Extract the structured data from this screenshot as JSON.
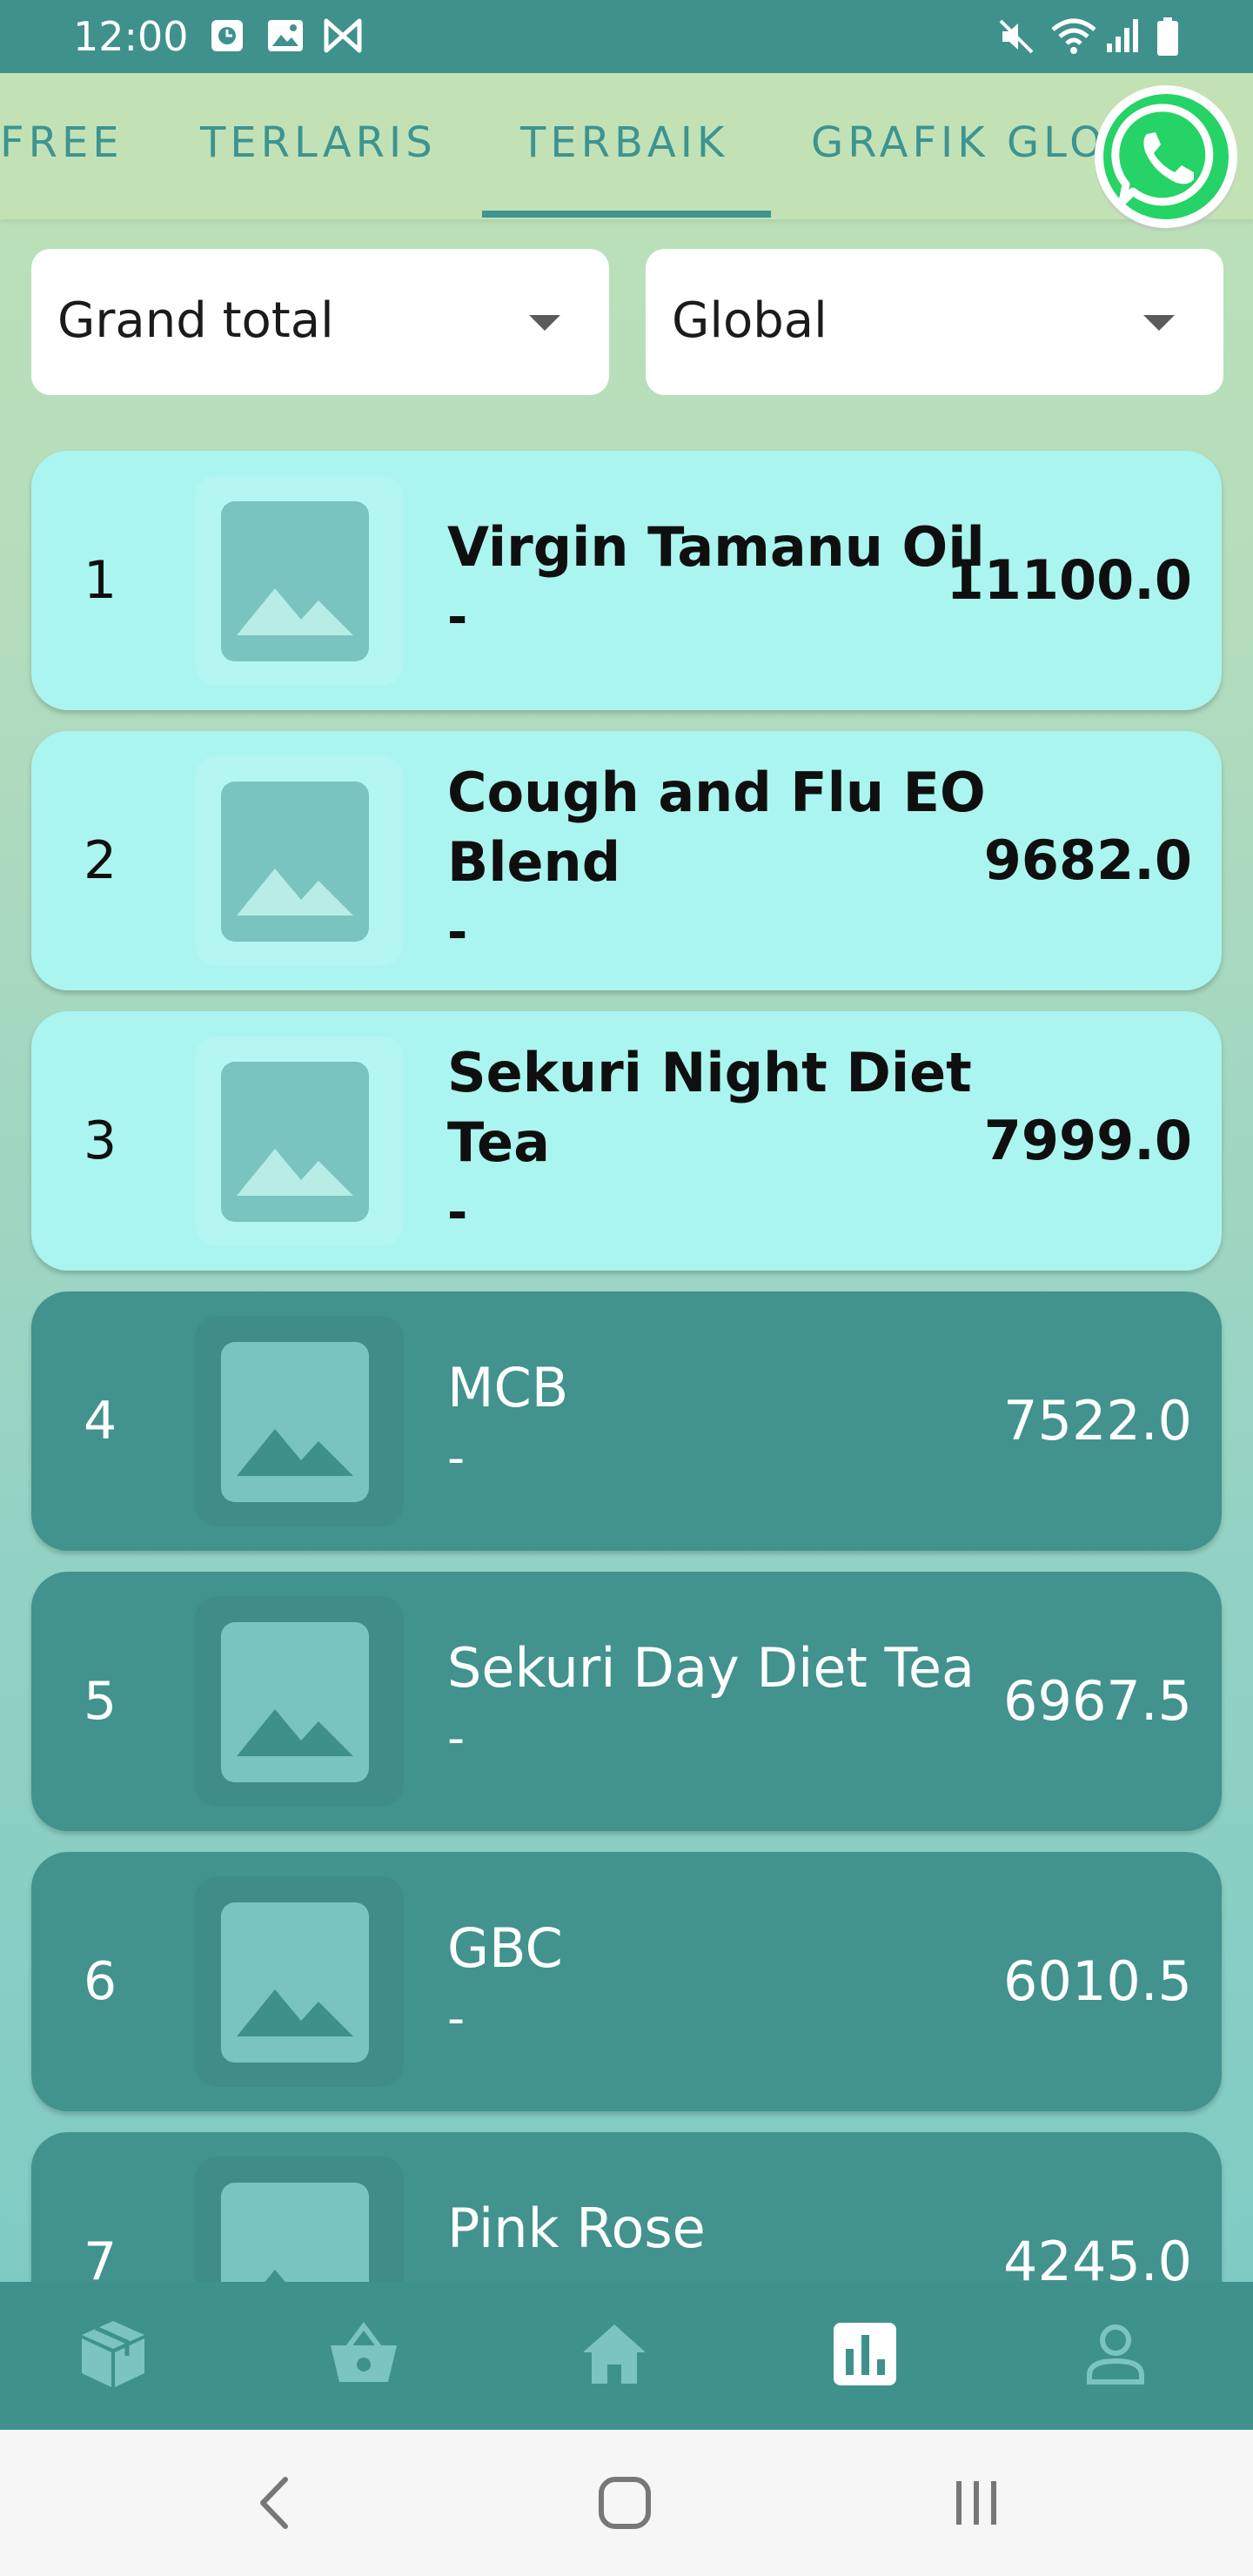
{
  "status_bar": {
    "time": "12:00",
    "left_icons": [
      "clock-icon",
      "image-icon",
      "m-logo-icon"
    ],
    "right_icons": [
      "mute-icon",
      "wifi-icon",
      "signal-icon",
      "battery-icon"
    ]
  },
  "tabs": [
    {
      "label": "FREE",
      "selected": false
    },
    {
      "label": "TERLARIS",
      "selected": false
    },
    {
      "label": "TERBAIK",
      "selected": true
    },
    {
      "label": "GRAFIK GLOBAL",
      "selected": false
    }
  ],
  "fab": {
    "icon": "whatsapp-icon"
  },
  "filters": {
    "metric": {
      "value": "Grand total"
    },
    "scope": {
      "value": "Global"
    }
  },
  "ranking": [
    {
      "rank": "1",
      "name": "Virgin Tamanu Oil",
      "subtitle": "-",
      "score": "11100.0",
      "highlight": true
    },
    {
      "rank": "2",
      "name": "Cough and Flu EO Blend",
      "subtitle": "-",
      "score": "9682.0",
      "highlight": true
    },
    {
      "rank": "3",
      "name": "Sekuri Night Diet Tea",
      "subtitle": "-",
      "score": "7999.0",
      "highlight": true
    },
    {
      "rank": "4",
      "name": "MCB",
      "subtitle": "-",
      "score": "7522.0",
      "highlight": false
    },
    {
      "rank": "5",
      "name": "Sekuri Day Diet Tea",
      "subtitle": "-",
      "score": "6967.5",
      "highlight": false
    },
    {
      "rank": "6",
      "name": "GBC",
      "subtitle": "-",
      "score": "6010.5",
      "highlight": false
    },
    {
      "rank": "7",
      "name": "Pink Rose",
      "subtitle": "-",
      "score": "4245.0",
      "highlight": false
    }
  ],
  "bottom_nav": [
    {
      "icon": "package-icon",
      "active": false
    },
    {
      "icon": "basket-icon",
      "active": false
    },
    {
      "icon": "home-icon",
      "active": false
    },
    {
      "icon": "chart-icon",
      "active": true
    },
    {
      "icon": "person-icon",
      "active": false
    }
  ],
  "system_nav": [
    "back-icon",
    "home-button-icon",
    "recents-icon"
  ],
  "colors": {
    "primary": "#3f918c",
    "highlight_card": "#aaf5ef",
    "normal_card": "#42928e",
    "tab_text": "#3d9490",
    "whatsapp": "#25d366"
  }
}
